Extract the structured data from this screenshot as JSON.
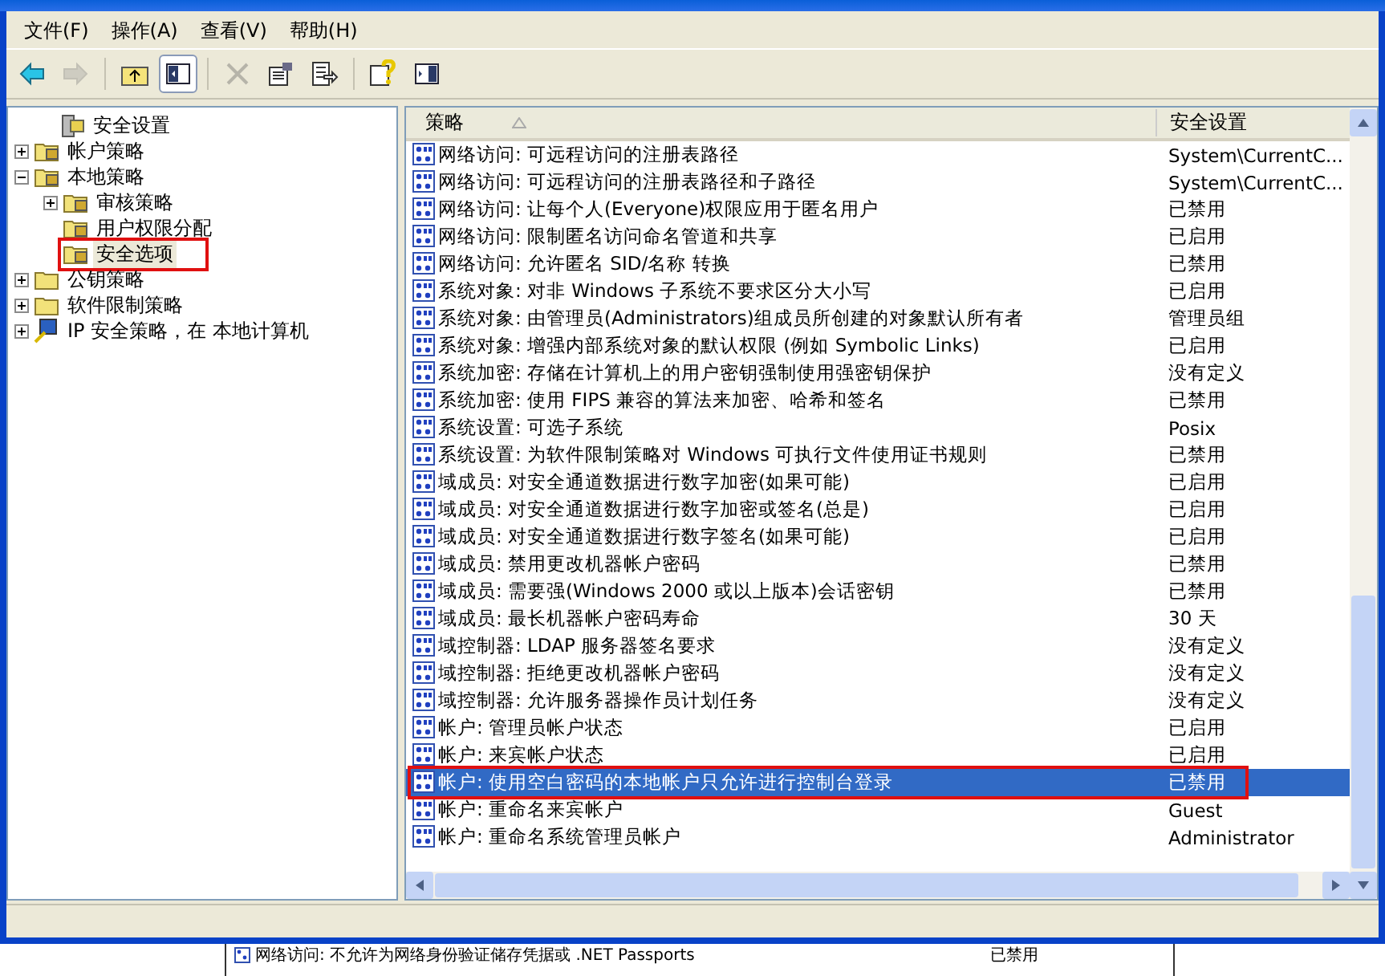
{
  "menu": [
    {
      "label": "文件(F)"
    },
    {
      "label": "操作(A)"
    },
    {
      "label": "查看(V)"
    },
    {
      "label": "帮助(H)"
    }
  ],
  "toolbar": [
    {
      "kind": "back",
      "disabled": false
    },
    {
      "kind": "forward",
      "disabled": true
    },
    {
      "kind": "sep"
    },
    {
      "kind": "up",
      "disabled": false
    },
    {
      "kind": "tree",
      "disabled": false,
      "pressed": true
    },
    {
      "kind": "sep"
    },
    {
      "kind": "delete",
      "disabled": true
    },
    {
      "kind": "properties",
      "disabled": false
    },
    {
      "kind": "export",
      "disabled": false
    },
    {
      "kind": "sep"
    },
    {
      "kind": "help",
      "disabled": false
    },
    {
      "kind": "console",
      "disabled": false
    }
  ],
  "tree": [
    {
      "label": "安全设置",
      "kind": "root",
      "children": [
        {
          "label": "帐户策略",
          "kind": "folder",
          "expanded": false
        },
        {
          "label": "本地策略",
          "kind": "folder",
          "expanded": true,
          "children": [
            {
              "label": "审核策略",
              "kind": "folder",
              "expanded": false
            },
            {
              "label": "用户权限分配",
              "kind": "folder"
            },
            {
              "label": "安全选项",
              "kind": "folder",
              "selected": true,
              "annotated": true
            }
          ]
        },
        {
          "label": "公钥策略",
          "kind": "plain",
          "expanded": false
        },
        {
          "label": "软件限制策略",
          "kind": "plain",
          "expanded": false
        },
        {
          "label": "IP 安全策略，在 本地计算机",
          "kind": "ip",
          "expanded": false
        }
      ]
    }
  ],
  "table": {
    "columns": [
      "策略",
      "安全设置"
    ],
    "rows": [
      {
        "policy": "网络访问: 可远程访问的注册表路径",
        "setting": "System\\CurrentC...",
        "selected": false
      },
      {
        "policy": "网络访问: 可远程访问的注册表路径和子路径",
        "setting": "System\\CurrentC...",
        "selected": false
      },
      {
        "policy": "网络访问: 让每个人(Everyone)权限应用于匿名用户",
        "setting": "已禁用",
        "selected": false
      },
      {
        "policy": "网络访问: 限制匿名访问命名管道和共享",
        "setting": "已启用",
        "selected": false
      },
      {
        "policy": "网络访问: 允许匿名 SID/名称 转换",
        "setting": "已禁用",
        "selected": false
      },
      {
        "policy": "系统对象: 对非 Windows 子系统不要求区分大小写",
        "setting": "已启用",
        "selected": false
      },
      {
        "policy": "系统对象: 由管理员(Administrators)组成员所创建的对象默认所有者",
        "setting": "管理员组",
        "selected": false
      },
      {
        "policy": "系统对象: 增强内部系统对象的默认权限 (例如 Symbolic Links)",
        "setting": "已启用",
        "selected": false
      },
      {
        "policy": "系统加密: 存储在计算机上的用户密钥强制使用强密钥保护",
        "setting": "没有定义",
        "selected": false
      },
      {
        "policy": "系统加密: 使用 FIPS 兼容的算法来加密、哈希和签名",
        "setting": "已禁用",
        "selected": false
      },
      {
        "policy": "系统设置: 可选子系统",
        "setting": "Posix",
        "selected": false
      },
      {
        "policy": "系统设置: 为软件限制策略对 Windows 可执行文件使用证书规则",
        "setting": "已禁用",
        "selected": false
      },
      {
        "policy": "域成员: 对安全通道数据进行数字加密(如果可能)",
        "setting": "已启用",
        "selected": false
      },
      {
        "policy": "域成员: 对安全通道数据进行数字加密或签名(总是)",
        "setting": "已启用",
        "selected": false
      },
      {
        "policy": "域成员: 对安全通道数据进行数字签名(如果可能)",
        "setting": "已启用",
        "selected": false
      },
      {
        "policy": "域成员: 禁用更改机器帐户密码",
        "setting": "已禁用",
        "selected": false
      },
      {
        "policy": "域成员: 需要强(Windows 2000 或以上版本)会话密钥",
        "setting": "已禁用",
        "selected": false
      },
      {
        "policy": "域成员: 最长机器帐户密码寿命",
        "setting": "30 天",
        "selected": false
      },
      {
        "policy": "域控制器: LDAP 服务器签名要求",
        "setting": "没有定义",
        "selected": false
      },
      {
        "policy": "域控制器: 拒绝更改机器帐户密码",
        "setting": "没有定义",
        "selected": false
      },
      {
        "policy": "域控制器: 允许服务器操作员计划任务",
        "setting": "没有定义",
        "selected": false
      },
      {
        "policy": "帐户: 管理员帐户状态",
        "setting": "已启用",
        "selected": false
      },
      {
        "policy": "帐户: 来宾帐户状态",
        "setting": "已启用",
        "selected": false
      },
      {
        "policy": "帐户: 使用空白密码的本地帐户只允许进行控制台登录",
        "setting": "已禁用",
        "selected": true,
        "annotated": true
      },
      {
        "policy": "帐户: 重命名来宾帐户",
        "setting": "Guest",
        "selected": false
      },
      {
        "policy": "帐户: 重命名系统管理员帐户",
        "setting": "Administrator",
        "selected": false
      }
    ]
  },
  "background_window": {
    "rows": [
      {
        "policy": "网络访问: 不允许为网络身份验证储存凭据或 .NET Passports",
        "setting": "已禁用"
      }
    ]
  }
}
